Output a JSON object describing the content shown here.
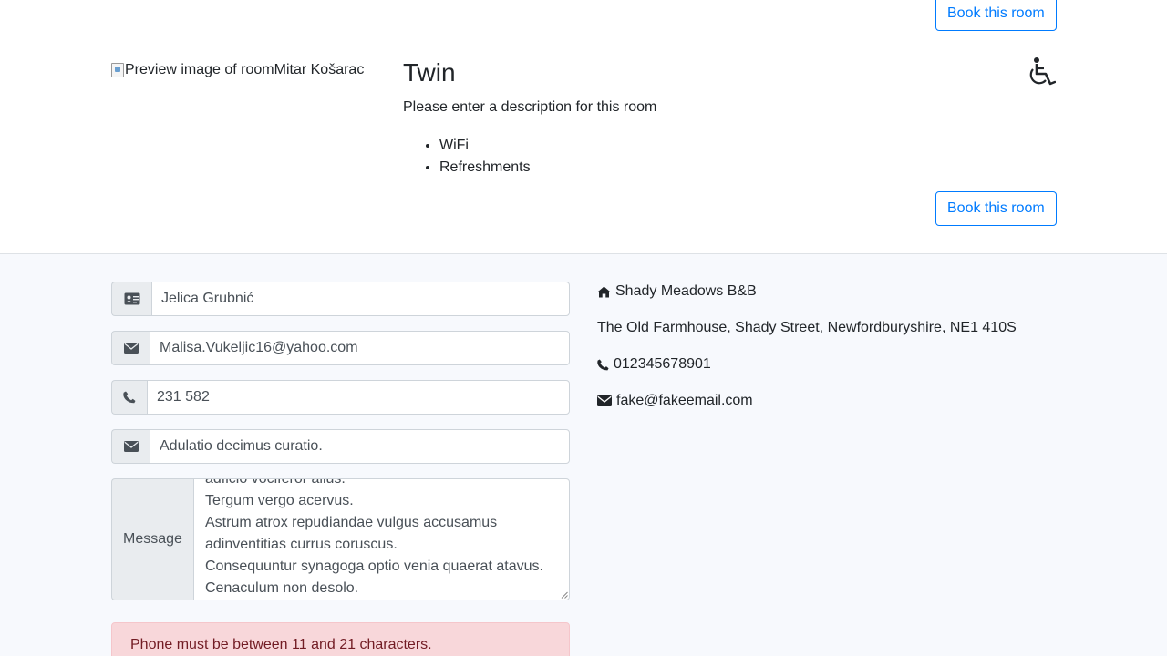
{
  "room": {
    "book_top_label": "Book this room",
    "book_bottom_label": "Book this room",
    "image_alt": "Preview image of room",
    "image_credit": "Mitar Košarac",
    "title": "Twin",
    "description": "Please enter a description for this room",
    "features": [
      "WiFi",
      "Refreshments"
    ]
  },
  "form": {
    "name_value": "Jelica Grubnić",
    "email_value": "Malisa.Vukeljic16@yahoo.com",
    "phone_value": "231 582",
    "subject_value": "Adulatio decimus curatio.",
    "message_label": "Message",
    "message_value": "adficio vociferor alius.\nTergum vergo acervus.\nAstrum atrox repudiandae vulgus accusamus adinventitias currus coruscus.\nConsequuntur synagoga optio venia quaerat atavus.\nCenaculum non desolo.",
    "error_text": "Phone must be between 11 and 21 characters."
  },
  "contact": {
    "business_name": "Shady Meadows B&B",
    "address": "The Old Farmhouse, Shady Street, Newfordburyshire, NE1 410S",
    "phone": "012345678901",
    "email": "fake@fakeemail.com"
  },
  "icons": {
    "accessible": "wheelchair-icon",
    "name": "id-card-icon",
    "email": "envelope-icon",
    "phone": "phone-icon",
    "subject": "envelope-icon",
    "home": "home-icon"
  },
  "colors": {
    "primary": "#007bff",
    "alert_bg": "#f8d7da",
    "alert_text": "#721c24",
    "lower_bg": "#f7f9fd"
  }
}
